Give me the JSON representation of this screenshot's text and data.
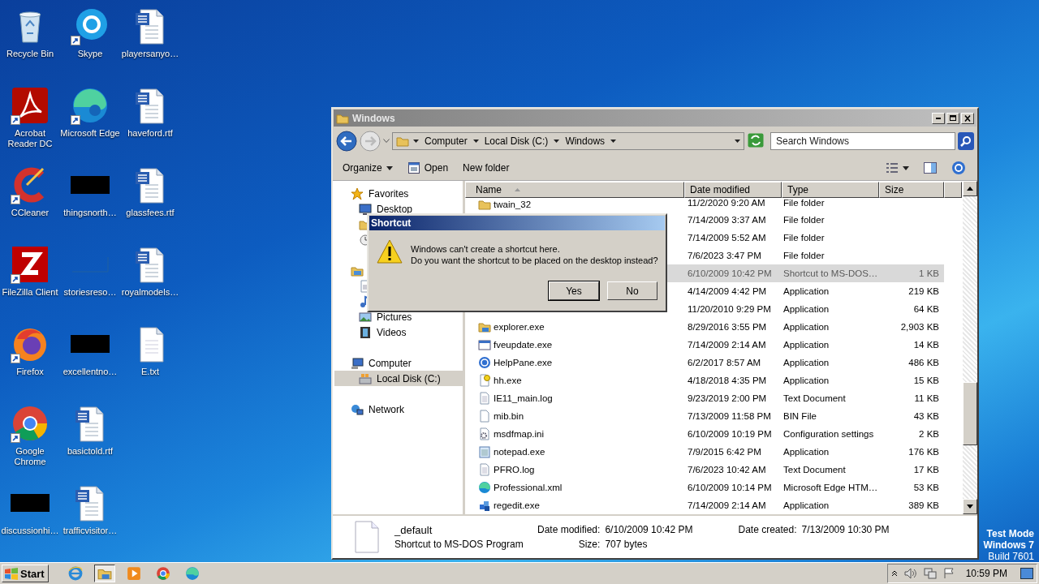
{
  "desktop": {
    "icons": [
      {
        "label": "Recycle Bin",
        "kind": "recycle",
        "shortcut": false
      },
      {
        "label": "Acrobat Reader DC",
        "kind": "acrobat",
        "shortcut": true
      },
      {
        "label": "CCleaner",
        "kind": "ccleaner",
        "shortcut": true
      },
      {
        "label": "FileZilla Client",
        "kind": "filezilla",
        "shortcut": true
      },
      {
        "label": "Firefox",
        "kind": "firefox",
        "shortcut": true
      },
      {
        "label": "Google Chrome",
        "kind": "chrome",
        "shortcut": true
      },
      {
        "label": "discussionhi…",
        "kind": "redacted",
        "shortcut": false
      },
      {
        "label": "Skype",
        "kind": "skype",
        "shortcut": true
      },
      {
        "label": "Microsoft Edge",
        "kind": "edge",
        "shortcut": true
      },
      {
        "label": "thingsnorth…",
        "kind": "redacted",
        "shortcut": false
      },
      {
        "label": "storiesreso…",
        "kind": "blank",
        "shortcut": false
      },
      {
        "label": "excellentno…",
        "kind": "redacted",
        "shortcut": false
      },
      {
        "label": "basictold.rtf",
        "kind": "word",
        "shortcut": false
      },
      {
        "label": "trafficvisitor…",
        "kind": "word",
        "shortcut": false
      },
      {
        "label": "playersanyo…",
        "kind": "word",
        "shortcut": false
      },
      {
        "label": "haveford.rtf",
        "kind": "word",
        "shortcut": false
      },
      {
        "label": "glassfees.rtf",
        "kind": "word",
        "shortcut": false
      },
      {
        "label": "royalmodels…",
        "kind": "word",
        "shortcut": false
      },
      {
        "label": "E.txt",
        "kind": "text",
        "shortcut": false
      }
    ],
    "watermark": [
      {
        "text": "Test Mode",
        "bold": true
      },
      {
        "text": "Windows 7",
        "bold": true
      },
      {
        "text": "Build 7601",
        "bold": false
      }
    ]
  },
  "explorer": {
    "title": "Windows",
    "address": {
      "crumbs": [
        "Computer",
        "Local Disk (C:)",
        "Windows"
      ]
    },
    "search": {
      "placeholder": "Search Windows"
    },
    "toolbar": [
      {
        "label": "Organize",
        "kind": "menu"
      },
      {
        "label": "Open",
        "kind": "open"
      },
      {
        "label": "New folder",
        "kind": "plain"
      }
    ],
    "nav": [
      {
        "label": "Favorites",
        "kind": "star",
        "selected": false,
        "children": [
          {
            "label": "Desktop",
            "kind": "desktop",
            "selected": false
          },
          {
            "kind": "folder",
            "selected": false
          },
          {
            "kind": "recent",
            "selected": false
          }
        ]
      },
      {
        "kind": "library",
        "selected": false,
        "children": [
          {
            "kind": "doc",
            "selected": false
          },
          {
            "kind": "music",
            "selected": false
          },
          {
            "label": "Pictures",
            "kind": "pictures",
            "selected": false
          },
          {
            "label": "Videos",
            "kind": "videos",
            "selected": false
          }
        ]
      },
      {
        "label": "Computer",
        "kind": "computer",
        "selected": false,
        "children": [
          {
            "label": "Local Disk (C:)",
            "kind": "disk",
            "selected": true
          }
        ]
      },
      {
        "label": "Network",
        "kind": "network",
        "selected": false
      }
    ],
    "columns": [
      {
        "label": "Name",
        "sorted": true
      },
      {
        "label": "Date modified",
        "sorted": false
      },
      {
        "label": "Type",
        "sorted": false
      },
      {
        "label": "Size",
        "sorted": false
      }
    ],
    "rows": [
      {
        "name": "twain_32",
        "kind": "folder",
        "date": "11/2/2020 9:20 AM",
        "type": "File folder",
        "selected": false
      },
      {
        "date": "7/14/2009 3:37 AM",
        "type": "File folder",
        "selected": false
      },
      {
        "date": "7/14/2009 5:52 AM",
        "type": "File folder",
        "selected": false
      },
      {
        "date": "7/6/2023 3:47 PM",
        "type": "File folder",
        "selected": false
      },
      {
        "date": "6/10/2009 10:42 PM",
        "type": "Shortcut to MS-DOS…",
        "size": "1 KB",
        "selected": true
      },
      {
        "date": "4/14/2009 4:42 PM",
        "type": "Application",
        "size": "219 KB",
        "selected": false
      },
      {
        "date": "11/20/2010 9:29 PM",
        "type": "Application",
        "size": "64 KB",
        "selected": false
      },
      {
        "name": "explorer.exe",
        "kind": "explorer",
        "date": "8/29/2016 3:55 PM",
        "type": "Application",
        "size": "2,903 KB",
        "selected": false
      },
      {
        "name": "fveupdate.exe",
        "kind": "window",
        "date": "7/14/2009 2:14 AM",
        "type": "Application",
        "size": "14 KB",
        "selected": false
      },
      {
        "name": "HelpPane.exe",
        "kind": "help",
        "date": "6/2/2017 8:57 AM",
        "type": "Application",
        "size": "486 KB",
        "selected": false
      },
      {
        "name": "hh.exe",
        "kind": "helpfile",
        "date": "4/18/2018 4:35 PM",
        "type": "Application",
        "size": "15 KB",
        "selected": false
      },
      {
        "name": "IE11_main.log",
        "kind": "text",
        "date": "9/23/2019 2:00 PM",
        "type": "Text Document",
        "size": "11 KB",
        "selected": false
      },
      {
        "name": "mib.bin",
        "kind": "blank",
        "date": "7/13/2009 11:58 PM",
        "type": "BIN File",
        "size": "43 KB",
        "selected": false
      },
      {
        "name": "msdfmap.ini",
        "kind": "settings",
        "date": "6/10/2009 10:19 PM",
        "type": "Configuration settings",
        "size": "2 KB",
        "selected": false
      },
      {
        "name": "notepad.exe",
        "kind": "notepad",
        "date": "7/9/2015 6:42 PM",
        "type": "Application",
        "size": "176 KB",
        "selected": false
      },
      {
        "name": "PFRO.log",
        "kind": "text",
        "date": "7/6/2023 10:42 AM",
        "type": "Text Document",
        "size": "17 KB",
        "selected": false
      },
      {
        "name": "Professional.xml",
        "kind": "edge",
        "date": "6/10/2009 10:14 PM",
        "type": "Microsoft Edge HTM…",
        "size": "53 KB",
        "selected": false
      },
      {
        "name": "regedit.exe",
        "kind": "registry",
        "date": "7/14/2009 2:14 AM",
        "type": "Application",
        "size": "389 KB",
        "selected": false
      }
    ],
    "details": {
      "name": "_default",
      "type": "Shortcut to MS-DOS Program",
      "properties": [
        {
          "label": "Date modified:",
          "value": "6/10/2009 10:42 PM"
        },
        {
          "label": "Size:",
          "value": "707 bytes"
        },
        {
          "label": "Date created:",
          "value": "7/13/2009 10:30 PM"
        }
      ]
    }
  },
  "dialog": {
    "title": "Shortcut",
    "lines": [
      "Windows can't create a shortcut here.",
      "Do you want the shortcut to be placed on the desktop instead?"
    ],
    "buttons": [
      {
        "label": "Yes",
        "default": true
      },
      {
        "label": "No",
        "default": false
      }
    ]
  },
  "taskbar": {
    "start": "Start",
    "apps": [
      {
        "kind": "ie",
        "active": false
      },
      {
        "kind": "explorer",
        "active": true
      },
      {
        "kind": "media",
        "active": false
      },
      {
        "kind": "chrome",
        "active": false
      },
      {
        "kind": "edge",
        "active": false
      }
    ],
    "clock": "10:59 PM"
  }
}
